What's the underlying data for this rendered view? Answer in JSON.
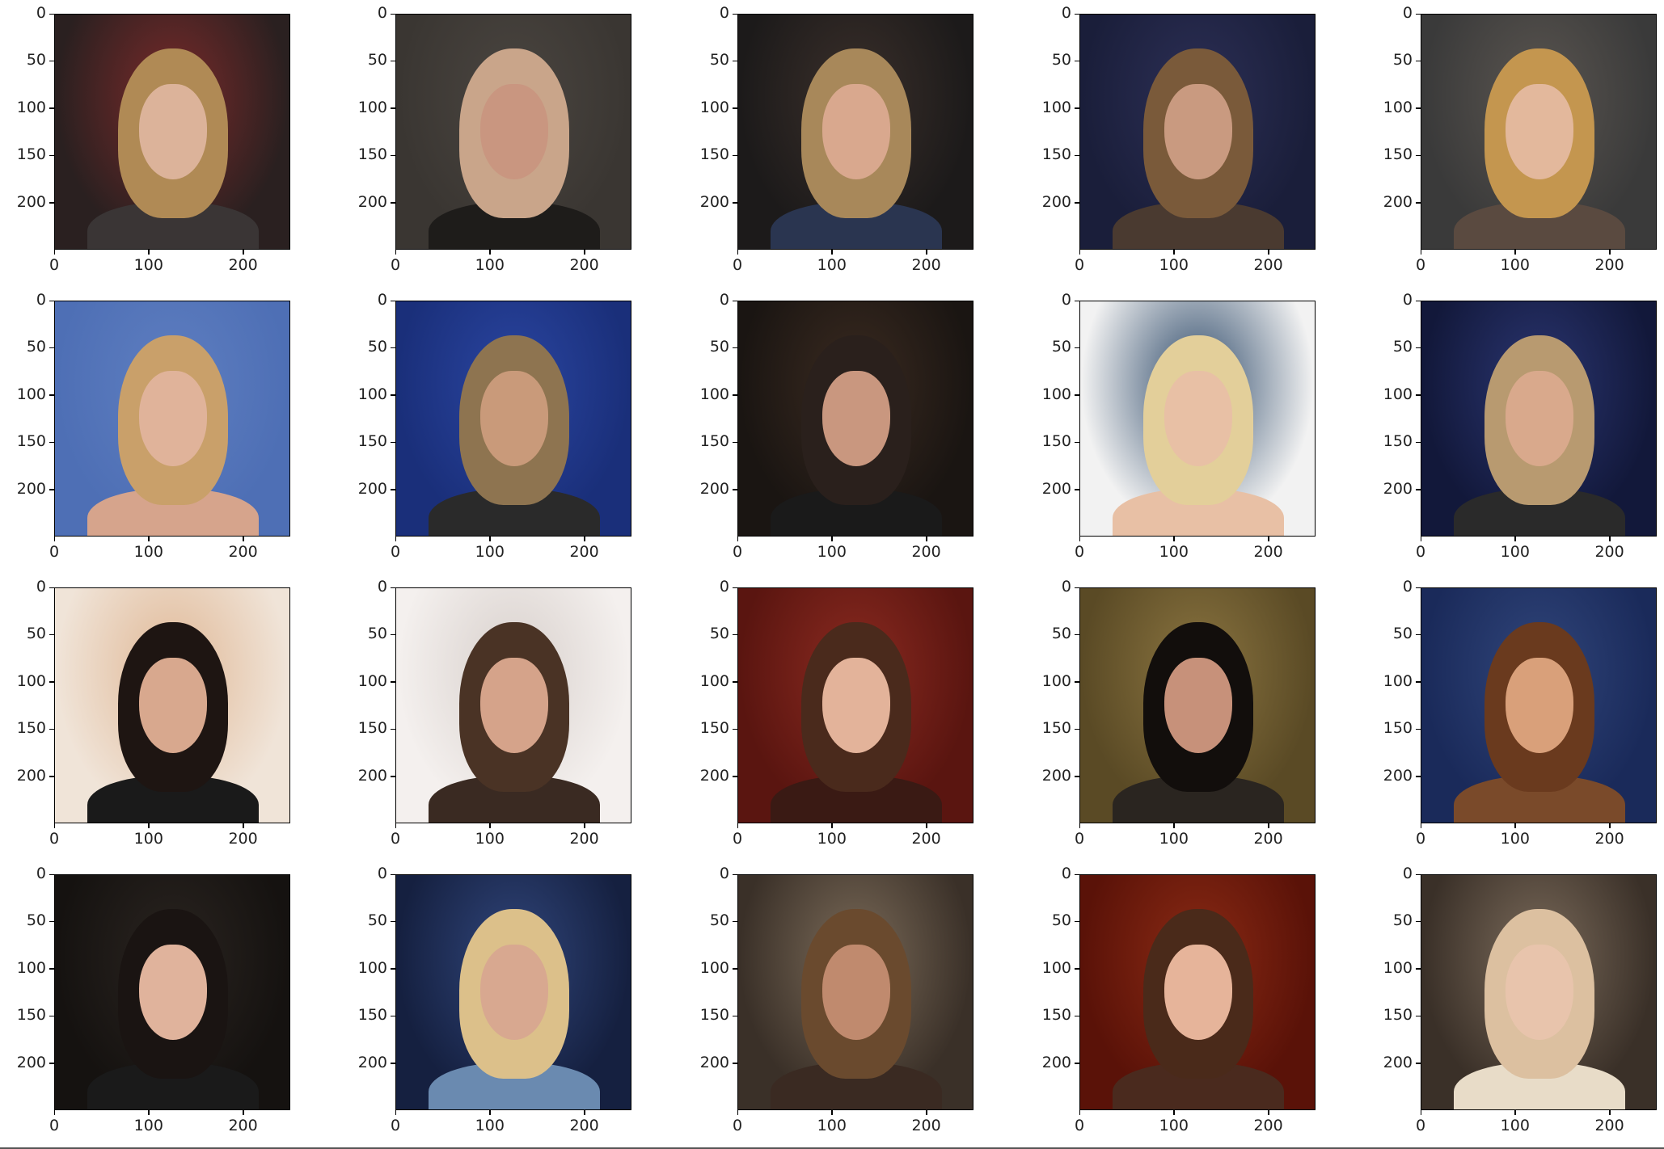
{
  "axes": {
    "y_ticks": [
      "0",
      "50",
      "100",
      "150",
      "200"
    ],
    "x_ticks": [
      "0",
      "100",
      "200"
    ]
  },
  "panels": [
    {
      "bg": "#2a2020",
      "bg2": "#7a2a2a",
      "hair": "#b08a55",
      "skin": "#dcb39a",
      "body": "#3a3535"
    },
    {
      "bg": "#3a3632",
      "bg2": "#4a4540",
      "hair": "#c9a58a",
      "skin": "#c99680",
      "body": "#1e1c1a"
    },
    {
      "bg": "#1c1a1a",
      "bg2": "#3a2f2a",
      "hair": "#a8885a",
      "skin": "#d9a88e",
      "body": "#2a3550"
    },
    {
      "bg": "#1a1e3a",
      "bg2": "#2c2f55",
      "hair": "#7a5a3a",
      "skin": "#c99a80",
      "body": "#4a3a30"
    },
    {
      "bg": "#3a3a3a",
      "bg2": "#5a5550",
      "hair": "#c4964f",
      "skin": "#e3b89c",
      "body": "#5a4a40"
    },
    {
      "bg": "#4e6fb5",
      "bg2": "#5e7ec0",
      "hair": "#c9a06a",
      "skin": "#e0b39a",
      "body": "#d6a48c"
    },
    {
      "bg": "#1a2f7a",
      "bg2": "#2a45a0",
      "hair": "#8e7450",
      "skin": "#c99a7a",
      "body": "#2a2a2a"
    },
    {
      "bg": "#1a1512",
      "bg2": "#3a2a20",
      "hair": "#2a201c",
      "skin": "#c9977f",
      "body": "#1a1a1a"
    },
    {
      "bg": "#f2f2f2",
      "bg2": "#2e4a6a",
      "hair": "#e3cf9a",
      "skin": "#e8c0a5",
      "body": "#e8c0a5"
    },
    {
      "bg": "#12183a",
      "bg2": "#2a3570",
      "hair": "#b89a70",
      "skin": "#d9a98c",
      "body": "#2a2a2a"
    },
    {
      "bg": "#f0e4d8",
      "bg2": "#e0b896",
      "hair": "#1e1512",
      "skin": "#d8a88e",
      "body": "#1a1a1a"
    },
    {
      "bg": "#f4f0ee",
      "bg2": "#d8d0cc",
      "hair": "#4a3325",
      "skin": "#d5a38a",
      "body": "#3a2a22"
    },
    {
      "bg": "#5a1510",
      "bg2": "#8a2a20",
      "hair": "#4a2a1c",
      "skin": "#e3b39a",
      "body": "#3a1a14"
    },
    {
      "bg": "#5a4a25",
      "bg2": "#8a7440",
      "hair": "#120e0c",
      "skin": "#c7917a",
      "body": "#2a2520"
    },
    {
      "bg": "#1a2a5a",
      "bg2": "#30457a",
      "hair": "#6a3a1e",
      "skin": "#d9a07a",
      "body": "#7a4a2a"
    },
    {
      "bg": "#151210",
      "bg2": "#2a2420",
      "hair": "#1a1412",
      "skin": "#e0b39c",
      "body": "#1a1a1a"
    },
    {
      "bg": "#152040",
      "bg2": "#30457a",
      "hair": "#dcc08a",
      "skin": "#d8a890",
      "body": "#6a8ab0"
    },
    {
      "bg": "#3a3028",
      "bg2": "#7a6a58",
      "hair": "#6a4a2e",
      "skin": "#c08a6e",
      "body": "#3a2a22"
    },
    {
      "bg": "#5a1208",
      "bg2": "#8a2a14",
      "hair": "#4a2a1a",
      "skin": "#e6b49a",
      "body": "#4a2a1e"
    },
    {
      "bg": "#3a3028",
      "bg2": "#7a6a5a",
      "hair": "#dcc0a0",
      "skin": "#e8c4ac",
      "body": "#e8dcc8"
    }
  ]
}
